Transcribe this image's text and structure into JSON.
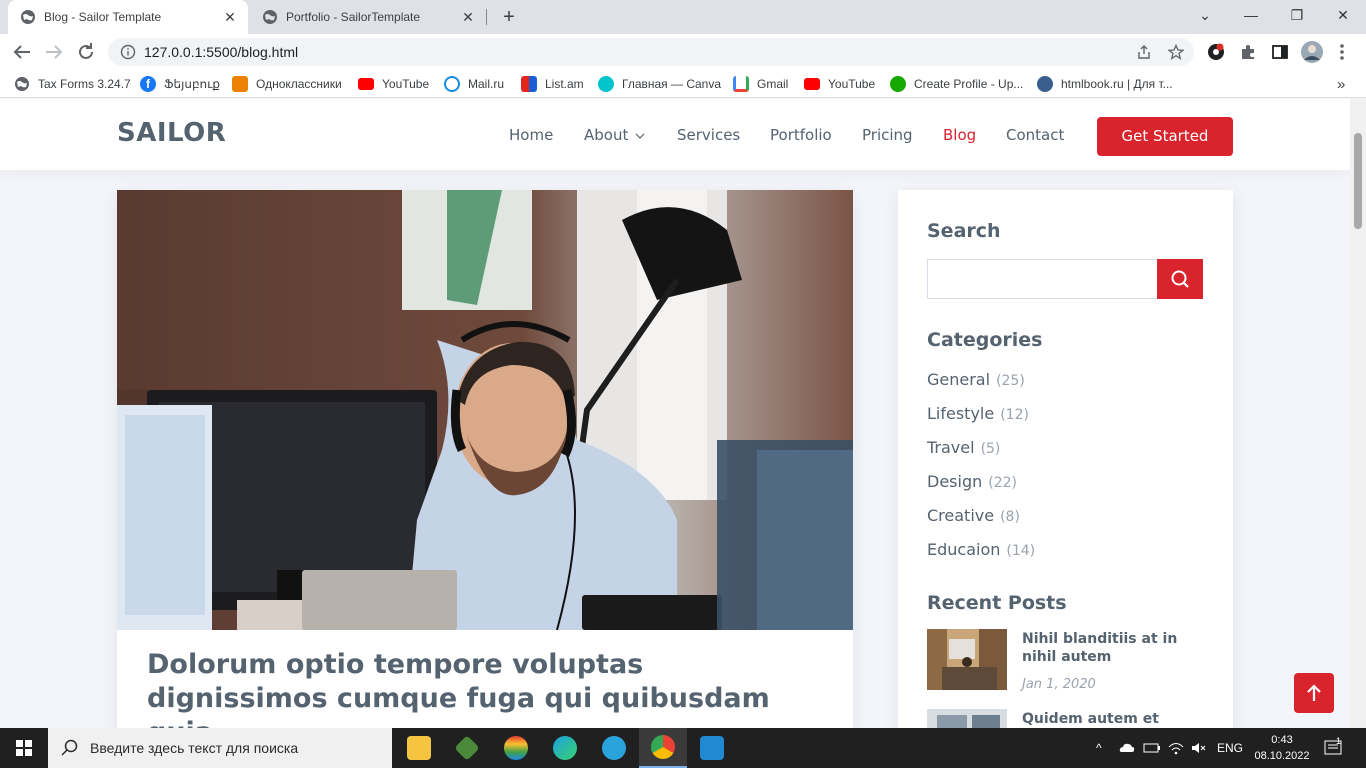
{
  "browser": {
    "tabs": [
      {
        "title": "Blog - Sailor Template",
        "active": true
      },
      {
        "title": "Portfolio - SailorTemplate",
        "active": false
      }
    ],
    "new_tab_glyph": "+",
    "window_controls": {
      "minimize": "—",
      "maximize": "❐",
      "close": "✕",
      "dropdown": "⌄"
    },
    "url": "127.0.0.1:5500/blog.html",
    "bookmarks": [
      {
        "label": "Tax Forms 3.24.7",
        "icon": "globe-icon",
        "color": "#5f6368"
      },
      {
        "label": "Ֆեյսբուք",
        "icon": "facebook-icon",
        "color": "#1877f2"
      },
      {
        "label": "Одноклассники",
        "icon": "ok-icon",
        "color": "#ee8208"
      },
      {
        "label": "YouTube",
        "icon": "youtube-icon",
        "color": "#ff0000"
      },
      {
        "label": "Mail.ru",
        "icon": "mailru-icon",
        "color": "#168de2"
      },
      {
        "label": "List.am",
        "icon": "listam-icon",
        "color": "#e5241b"
      },
      {
        "label": "Главная — Canva",
        "icon": "canva-icon",
        "color": "#00c4cc"
      },
      {
        "label": "Gmail",
        "icon": "gmail-icon",
        "color": "#ea4335"
      },
      {
        "label": "YouTube",
        "icon": "youtube-icon",
        "color": "#ff0000"
      },
      {
        "label": "Create Profile - Up...",
        "icon": "upwork-icon",
        "color": "#14a800"
      },
      {
        "label": "htmlbook.ru | Для т...",
        "icon": "htmlbook-icon",
        "color": "#3a5f8f"
      }
    ],
    "more_bookmarks": "»"
  },
  "site": {
    "logo": "SAILOR",
    "nav": [
      {
        "label": "Home",
        "active": false
      },
      {
        "label": "About",
        "active": false,
        "dropdown": true
      },
      {
        "label": "Services",
        "active": false
      },
      {
        "label": "Portfolio",
        "active": false
      },
      {
        "label": "Pricing",
        "active": false
      },
      {
        "label": "Blog",
        "active": true
      },
      {
        "label": "Contact",
        "active": false
      }
    ],
    "cta": "Get Started",
    "accent": "#d9232d",
    "text_color": "#556270"
  },
  "article": {
    "title": "Dolorum optio tempore voluptas dignissimos cumque fuga qui quibusdam quia"
  },
  "sidebar": {
    "search_title": "Search",
    "search_placeholder": "",
    "categories_title": "Categories",
    "categories": [
      {
        "name": "General",
        "count": "(25)"
      },
      {
        "name": "Lifestyle",
        "count": "(12)"
      },
      {
        "name": "Travel",
        "count": "(5)"
      },
      {
        "name": "Design",
        "count": "(22)"
      },
      {
        "name": "Creative",
        "count": "(8)"
      },
      {
        "name": "Educaion",
        "count": "(14)"
      }
    ],
    "recent_title": "Recent Posts",
    "recent_posts": [
      {
        "title": "Nihil blanditiis at in nihil autem",
        "date": "Jan 1, 2020"
      },
      {
        "title": "Quidem autem et",
        "date": ""
      }
    ]
  },
  "taskbar": {
    "search_placeholder": "Введите здесь текст для поиска",
    "apps": [
      "file-explorer-icon",
      "git-icon",
      "colorful-app-icon",
      "edge-icon",
      "telegram-icon",
      "chrome-icon",
      "vscode-icon"
    ],
    "lang": "ENG",
    "time": "0:43",
    "date": "08.10.2022",
    "notifications": "1"
  }
}
